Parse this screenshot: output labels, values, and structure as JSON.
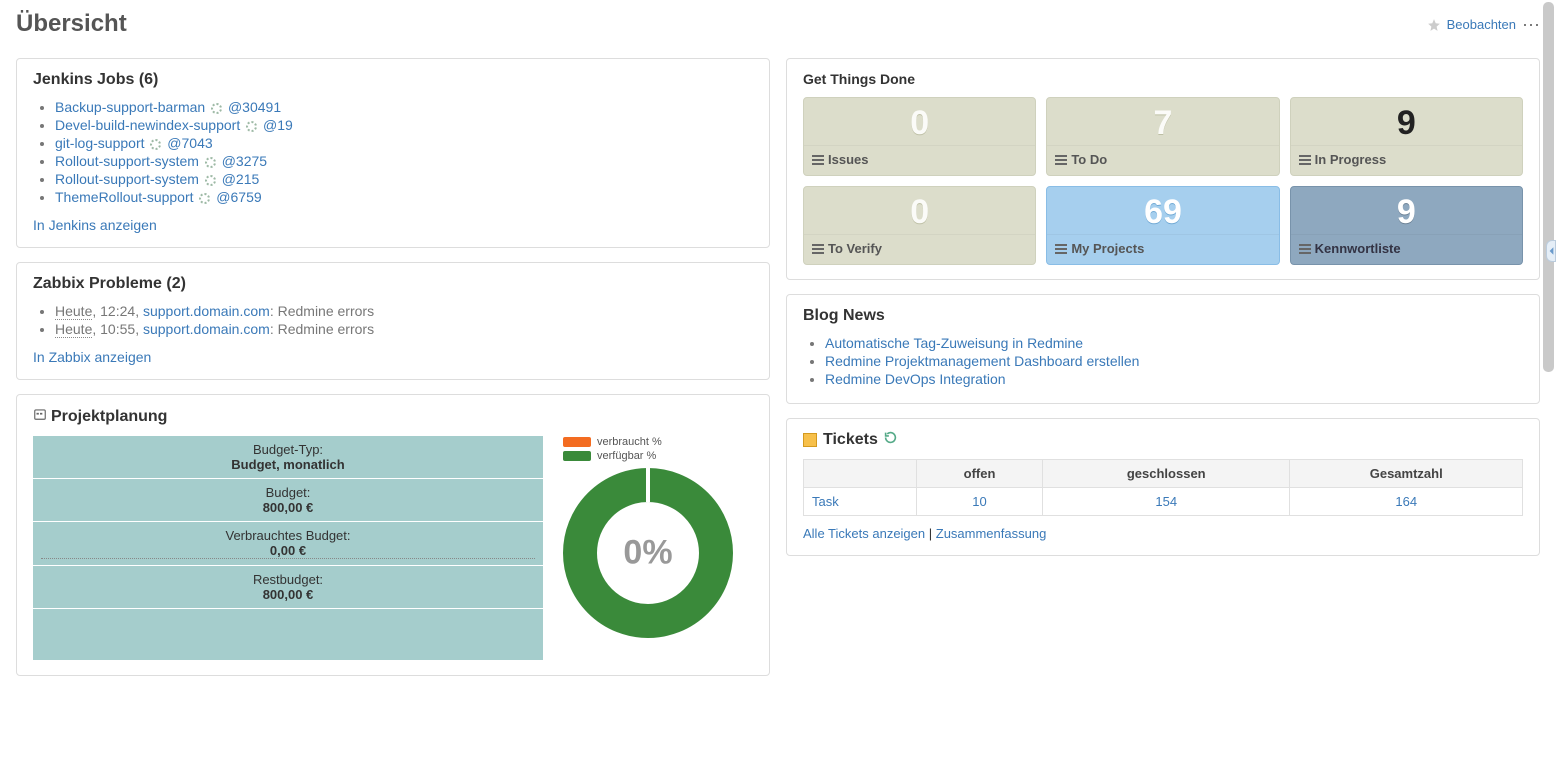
{
  "page": {
    "title": "Übersicht"
  },
  "header_actions": {
    "watch": "Beobachten"
  },
  "jenkins": {
    "title": "Jenkins Jobs (6)",
    "jobs": [
      {
        "name": "Backup-support-barman",
        "build": "@30491"
      },
      {
        "name": "Devel-build-newindex-support",
        "build": "@19"
      },
      {
        "name": "git-log-support",
        "build": "@7043"
      },
      {
        "name": "Rollout-support-system",
        "build": "@3275"
      },
      {
        "name": "Rollout-support-system",
        "build": "@215"
      },
      {
        "name": "ThemeRollout-support",
        "build": "@6759"
      }
    ],
    "footer": "In Jenkins anzeigen"
  },
  "zabbix": {
    "title": "Zabbix Probleme (2)",
    "items": [
      {
        "day": "Heute",
        "time": "12:24",
        "host": "support.domain.com",
        "msg": "Redmine errors"
      },
      {
        "day": "Heute",
        "time": "10:55",
        "host": "support.domain.com",
        "msg": "Redmine errors"
      }
    ],
    "footer": "In Zabbix anzeigen"
  },
  "planning": {
    "title": "Projektplanung",
    "rows": [
      {
        "label": "Budget-Typ:",
        "value": "Budget, monatlich"
      },
      {
        "label": "Budget:",
        "value": "800,00 €"
      },
      {
        "label": "Verbrauchtes Budget:",
        "value": "0,00 €"
      },
      {
        "label": "Restbudget:",
        "value": "800,00 €"
      }
    ],
    "legend": {
      "used": "verbraucht %",
      "avail": "verfügbar %"
    },
    "center_pct": "0%"
  },
  "gtd": {
    "title": "Get Things Done",
    "cards": [
      {
        "num": "0",
        "label": "Issues",
        "variant": "",
        "num_dark": false
      },
      {
        "num": "7",
        "label": "To Do",
        "variant": "",
        "num_dark": false
      },
      {
        "num": "9",
        "label": "In Progress",
        "variant": "",
        "num_dark": true
      },
      {
        "num": "0",
        "label": "To Verify",
        "variant": "",
        "num_dark": false
      },
      {
        "num": "69",
        "label": "My Projects",
        "variant": "blue",
        "num_dark": false
      },
      {
        "num": "9",
        "label": "Kennwortliste",
        "variant": "steel",
        "num_dark": false
      }
    ]
  },
  "blog": {
    "title": "Blog News",
    "items": [
      "Automatische Tag-Zuweisung in Redmine",
      "Redmine Projektmanagement Dashboard erstellen",
      "Redmine DevOps Integration"
    ]
  },
  "tickets": {
    "title": "Tickets",
    "columns": {
      "open": "offen",
      "closed": "geschlossen",
      "total": "Gesamtzahl"
    },
    "rows": [
      {
        "tracker": "Task",
        "open": "10",
        "closed": "154",
        "total": "164"
      }
    ],
    "footer": {
      "all": "Alle Tickets anzeigen",
      "summary": "Zusammenfassung"
    }
  },
  "chart_data": {
    "type": "pie",
    "title": "",
    "series": [
      {
        "name": "verbraucht %",
        "values": [
          0
        ],
        "color": "#f36c21"
      },
      {
        "name": "verfügbar %",
        "values": [
          100
        ],
        "color": "#3a8a3a"
      }
    ],
    "center_label": "0%"
  }
}
